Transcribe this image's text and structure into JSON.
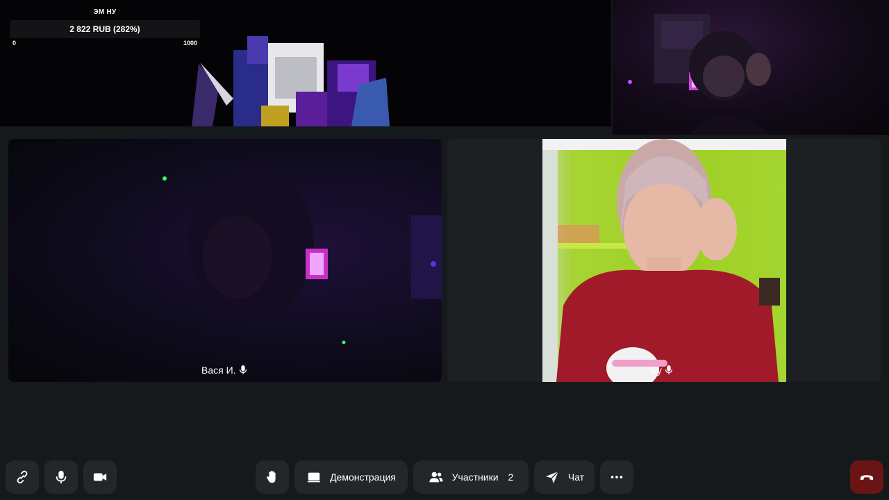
{
  "donation_widget": {
    "title": "ЭМ НУ",
    "amount": "2 822 RUB (282%)",
    "min": "0",
    "max": "1000"
  },
  "participants": [
    {
      "name": "Вася И.",
      "mic_icon": "mic-icon"
    },
    {
      "name": "Бу",
      "mic_icon": "mic-icon"
    }
  ],
  "toolbar": {
    "link_icon": "link-icon",
    "mic_icon": "microphone-icon",
    "camera_icon": "camera-icon",
    "hand_icon": "raise-hand-icon",
    "screen_share_label": "Демонстрация",
    "participants_label": "Участники",
    "participants_count": "2",
    "chat_label": "Чат",
    "more_icon": "more-icon",
    "hangup_icon": "hangup-icon"
  },
  "colors": {
    "background": "#16191b",
    "button": "#23272a",
    "hangup": "#6b1416",
    "green_wall": "#9fd026"
  }
}
